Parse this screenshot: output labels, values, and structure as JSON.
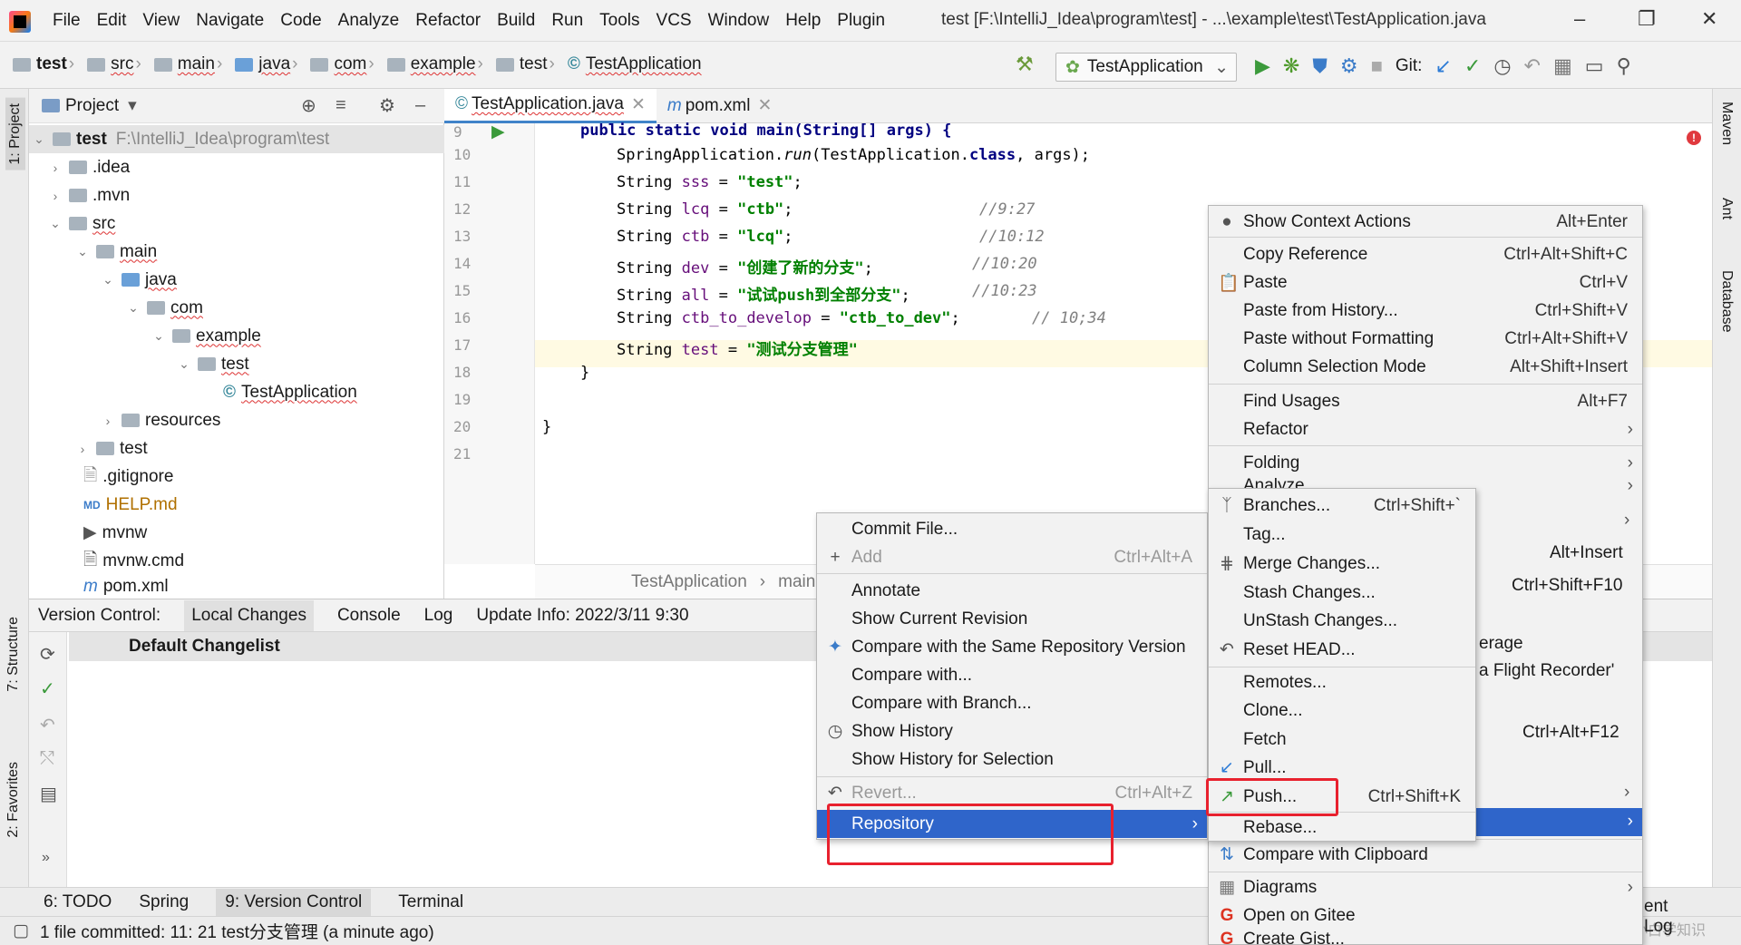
{
  "app": {
    "menu": [
      "File",
      "Edit",
      "View",
      "Navigate",
      "Code",
      "Analyze",
      "Refactor",
      "Build",
      "Run",
      "Tools",
      "VCS",
      "Window",
      "Help",
      "Plugin"
    ],
    "window_title": "test [F:\\IntelliJ_Idea\\program\\test] - ...\\example\\test\\TestApplication.java"
  },
  "breadcrumbs": [
    "test",
    "src",
    "main",
    "java",
    "com",
    "example",
    "test",
    "TestApplication"
  ],
  "run_config": "TestApplication",
  "git_label": "Git:",
  "project_panel": {
    "title": "Project",
    "root_name": "test",
    "root_path": "F:\\IntelliJ_Idea\\program\\test",
    "items": [
      ".idea",
      ".mvn",
      "src",
      "main",
      "java",
      "com",
      "example",
      "test",
      "TestApplication",
      "resources",
      "test",
      ".gitignore",
      "HELP.md",
      "mvnw",
      "mvnw.cmd",
      "pom.xml"
    ]
  },
  "editor": {
    "tabs": [
      "TestApplication.java",
      "pom.xml"
    ],
    "line_numbers": [
      "9",
      "10",
      "11",
      "12",
      "13",
      "14",
      "15",
      "16",
      "17",
      "18",
      "19",
      "20",
      "21"
    ],
    "lines": {
      "l9": "public static void main(String[] args) {",
      "l10a": "SpringApplication.",
      "l10b": "run",
      "l10c": "(TestApplication.",
      "l10d": "class",
      "l10e": ", args);",
      "l11_var": "sss",
      "l11_str": "\"test\"",
      "l12_var": "lcq",
      "l12_str": "\"ctb\"",
      "l12_cmt": "//9:27",
      "l13_var": "ctb",
      "l13_str": "\"lcq\"",
      "l13_cmt": "//10:12",
      "l14_var": "dev",
      "l14_str": "\"创建了新的分支\"",
      "l14_cmt": "//10:20",
      "l15_var": "all",
      "l15_str": "\"试试push到全部分支\"",
      "l15_cmt": "//10:23",
      "l16_var": "ctb_to_develop",
      "l16_str": "\"ctb_to_dev\"",
      "l16_cmt": "// 10;34",
      "l17_var": "test",
      "l17_str": "\"测试分支管理\"",
      "string_kw": "String",
      "eq": " = ",
      "semi": ";",
      "brace": "}"
    },
    "breadcrumb": [
      "TestApplication",
      "main()"
    ]
  },
  "version_control": {
    "label": "Version Control:",
    "tabs": [
      "Local Changes",
      "Console",
      "Log",
      "Update Info: 2022/3/11 9:30"
    ],
    "changelist": "Default Changelist"
  },
  "context_menu": {
    "items": [
      {
        "label": "Show Context Actions",
        "shortcut": "Alt+Enter"
      },
      {
        "label": "Copy Reference",
        "shortcut": "Ctrl+Alt+Shift+C"
      },
      {
        "label": "Paste",
        "shortcut": "Ctrl+V"
      },
      {
        "label": "Paste from History...",
        "shortcut": "Ctrl+Shift+V"
      },
      {
        "label": "Paste without Formatting",
        "shortcut": "Ctrl+Alt+Shift+V"
      },
      {
        "label": "Column Selection Mode",
        "shortcut": "Alt+Shift+Insert"
      },
      {
        "label": "Find Usages",
        "shortcut": "Alt+F7"
      },
      {
        "label": "Refactor",
        "shortcut": ""
      },
      {
        "label": "Folding",
        "shortcut": ""
      },
      {
        "label": "Analyze",
        "shortcut": ""
      }
    ],
    "partial": [
      "Alt+Insert",
      "Ctrl+Shift+F10",
      "erage",
      "a Flight Recorder'",
      "Ctrl+Alt+F12",
      "ent Log"
    ]
  },
  "git_menu": {
    "items": [
      {
        "label": "Commit File...",
        "shortcut": ""
      },
      {
        "label": "Add",
        "shortcut": "Ctrl+Alt+A"
      },
      {
        "label": "Annotate",
        "shortcut": ""
      },
      {
        "label": "Show Current Revision",
        "shortcut": ""
      },
      {
        "label": "Compare with the Same Repository Version",
        "shortcut": ""
      },
      {
        "label": "Compare with...",
        "shortcut": ""
      },
      {
        "label": "Compare with Branch...",
        "shortcut": ""
      },
      {
        "label": "Show History",
        "shortcut": ""
      },
      {
        "label": "Show History for Selection",
        "shortcut": ""
      },
      {
        "label": "Revert...",
        "shortcut": "Ctrl+Alt+Z"
      },
      {
        "label": "Repository",
        "shortcut": ""
      }
    ]
  },
  "repo_menu": {
    "items": [
      {
        "label": "Branches...",
        "shortcut": "Ctrl+Shift+`"
      },
      {
        "label": "Tag...",
        "shortcut": ""
      },
      {
        "label": "Merge Changes...",
        "shortcut": ""
      },
      {
        "label": "Stash Changes...",
        "shortcut": ""
      },
      {
        "label": "UnStash Changes...",
        "shortcut": ""
      },
      {
        "label": "Reset HEAD...",
        "shortcut": ""
      },
      {
        "label": "Remotes...",
        "shortcut": ""
      },
      {
        "label": "Clone...",
        "shortcut": ""
      },
      {
        "label": "Fetch",
        "shortcut": ""
      },
      {
        "label": "Pull...",
        "shortcut": ""
      },
      {
        "label": "Push...",
        "shortcut": "Ctrl+Shift+K"
      },
      {
        "label": "Rebase...",
        "shortcut": ""
      }
    ]
  },
  "context_menu_bottom": [
    "Compare with Clipboard",
    "Diagrams",
    "Open on Gitee",
    "Create Gist..."
  ],
  "left_strip": [
    "1: Project",
    "7: Structure",
    "2: Favorites"
  ],
  "right_strip": [
    "Maven",
    "Ant",
    "Database"
  ],
  "bottom_tabs": [
    "6: TODO",
    "Spring",
    "9: Version Control",
    "Terminal"
  ],
  "status": "1 file committed: 11: 21 test分支管理 (a minute ago)",
  "watermark": "CSDN @小白学知识",
  "colors": {
    "selection": "#2f65ca",
    "highlight_box": "#e8212e",
    "string": "#008000",
    "keyword": "#000080"
  }
}
